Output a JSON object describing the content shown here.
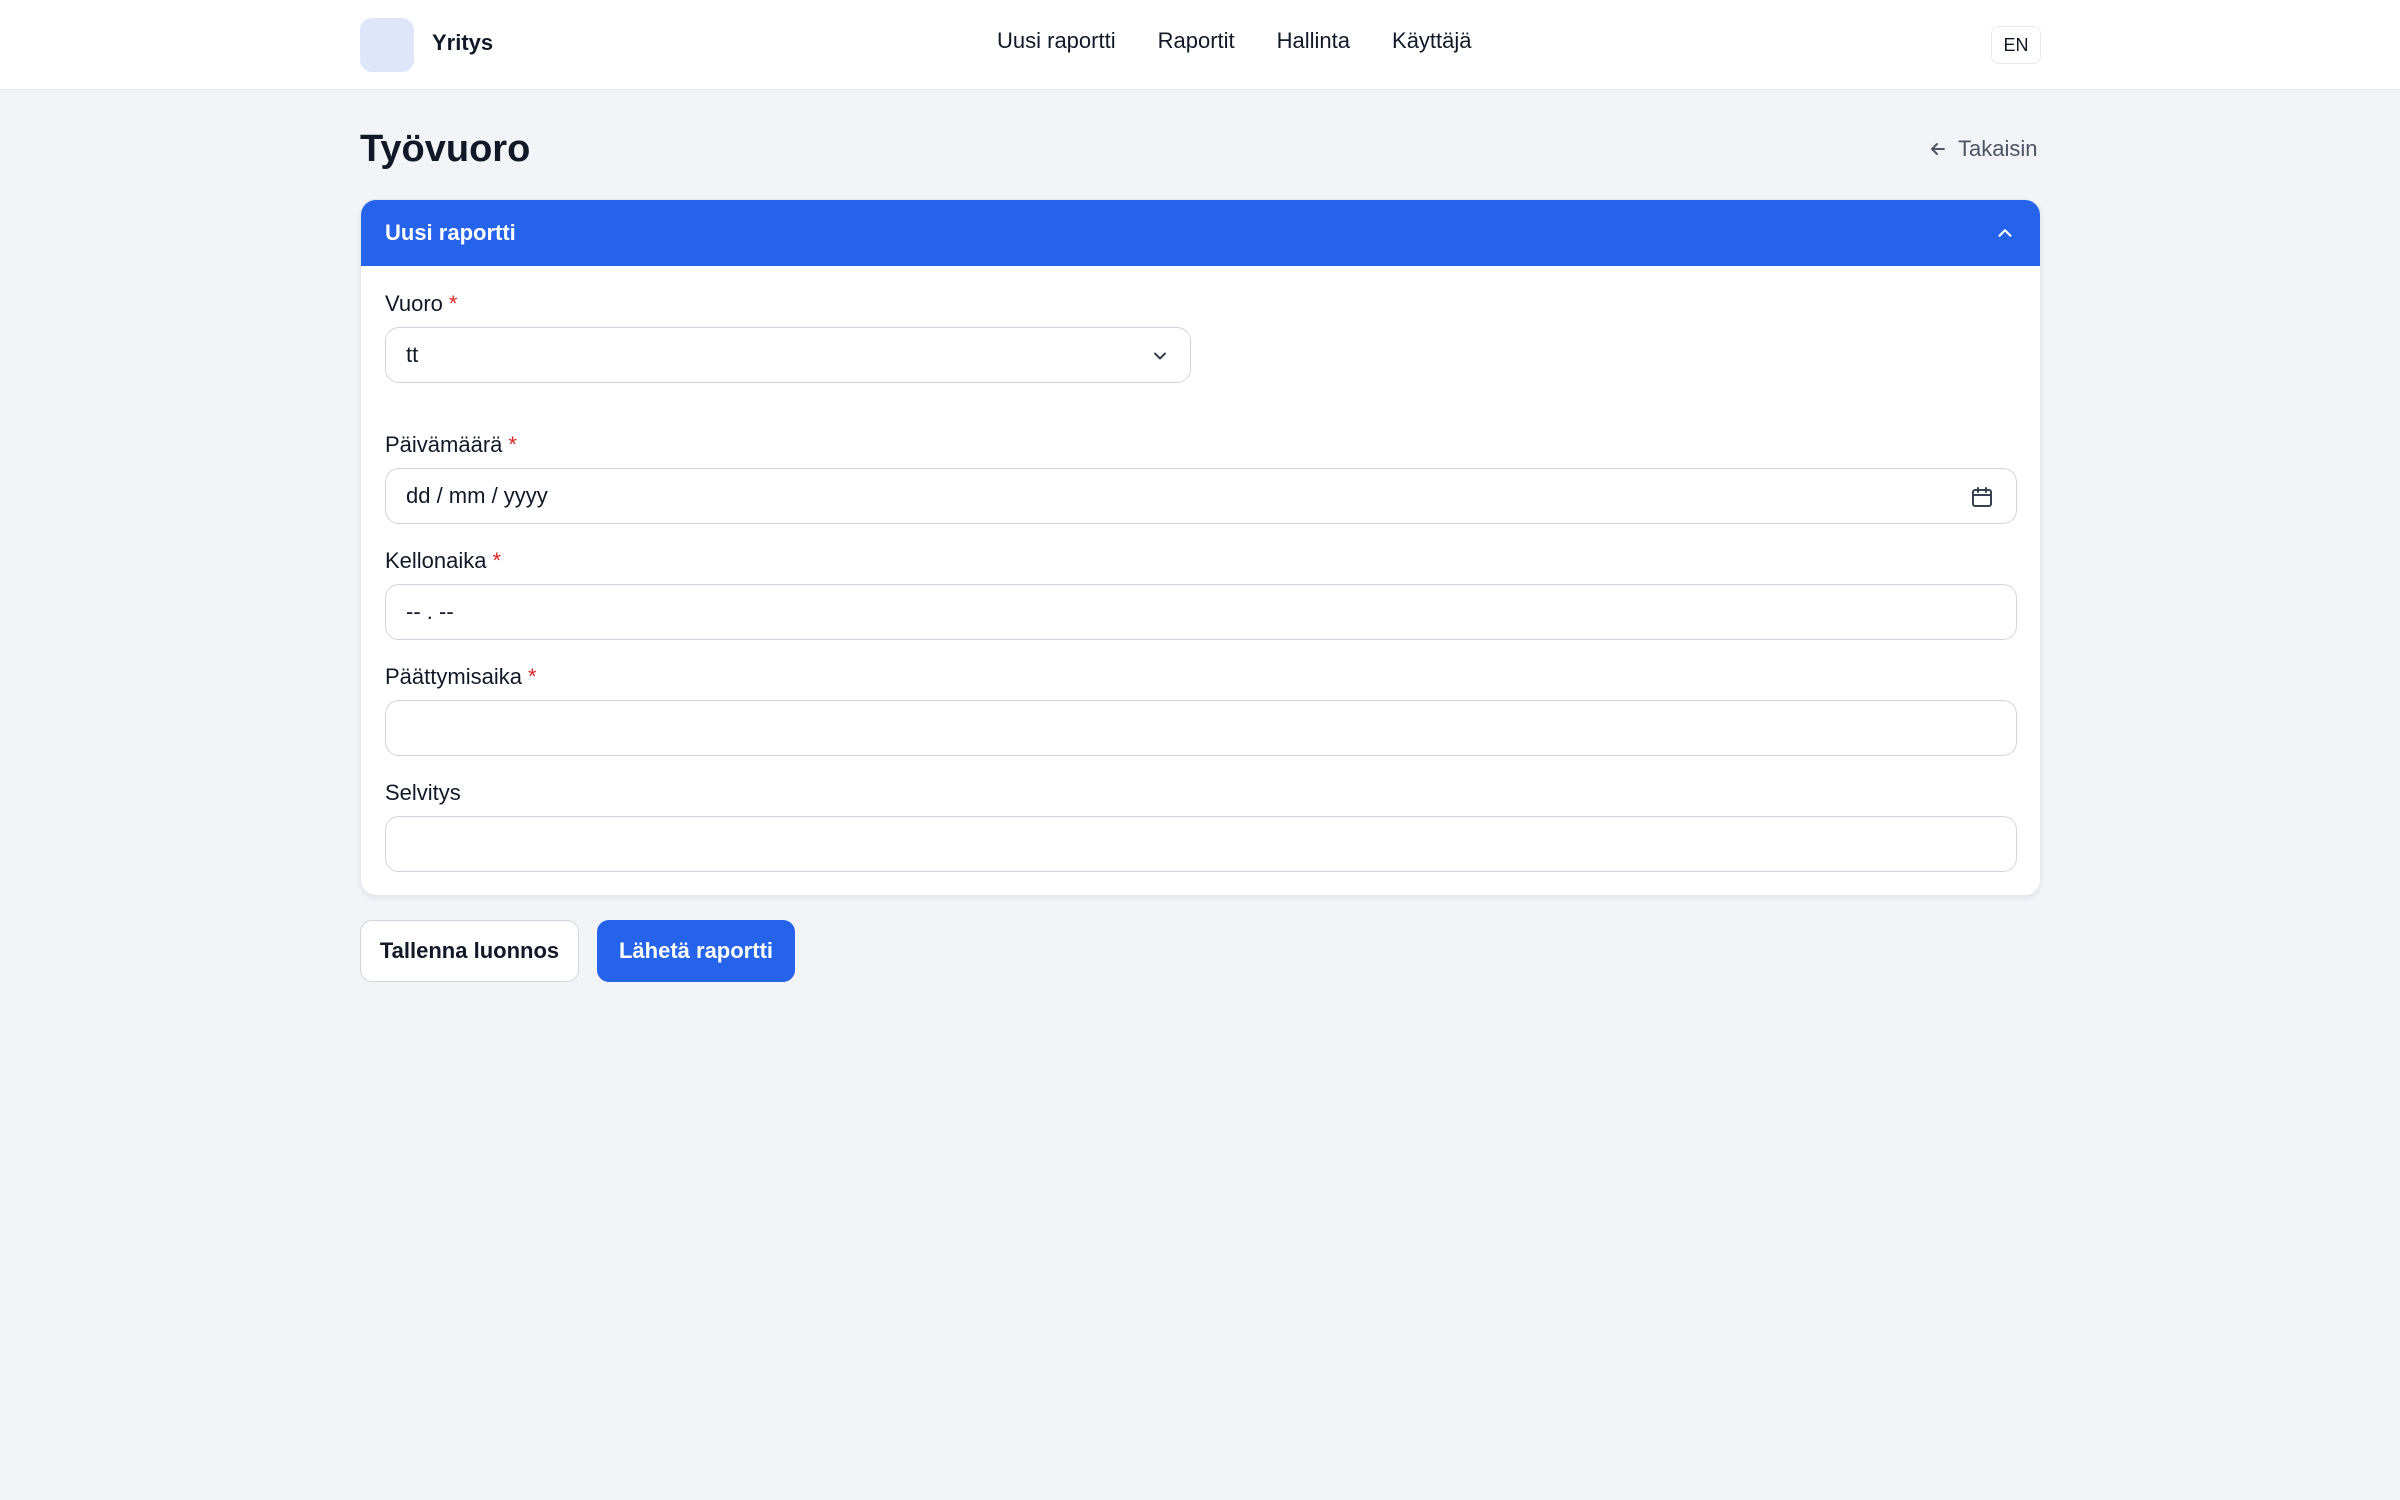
{
  "header": {
    "brand": "Yritys",
    "nav": [
      "Uusi raportti",
      "Raportit",
      "Hallinta",
      "Käyttäjä"
    ],
    "language": "EN"
  },
  "page": {
    "title": "Työvuoro",
    "back_label": "Takaisin"
  },
  "card": {
    "title": "Uusi raportti",
    "fields": {
      "shift": {
        "label": "Vuoro",
        "required": "*",
        "value": "tt"
      },
      "date": {
        "label": "Päivämäärä",
        "required": "*",
        "placeholder": "dd / mm / yyyy"
      },
      "time": {
        "label": "Kellonaika",
        "required": "*",
        "placeholder": "-- . --"
      },
      "end_time": {
        "label": "Päättymisaika",
        "required": "*",
        "value": ""
      },
      "explanation": {
        "label": "Selvitys",
        "value": ""
      }
    }
  },
  "actions": {
    "save_draft": "Tallenna luonnos",
    "submit": "Lähetä raportti"
  },
  "colors": {
    "primary": "#2563eb",
    "background": "#f3f4f8",
    "required": "#dc2626"
  },
  "icons": [
    "logo",
    "arrow-left-icon",
    "chevron-up-icon",
    "chevron-down-icon",
    "calendar-icon"
  ]
}
